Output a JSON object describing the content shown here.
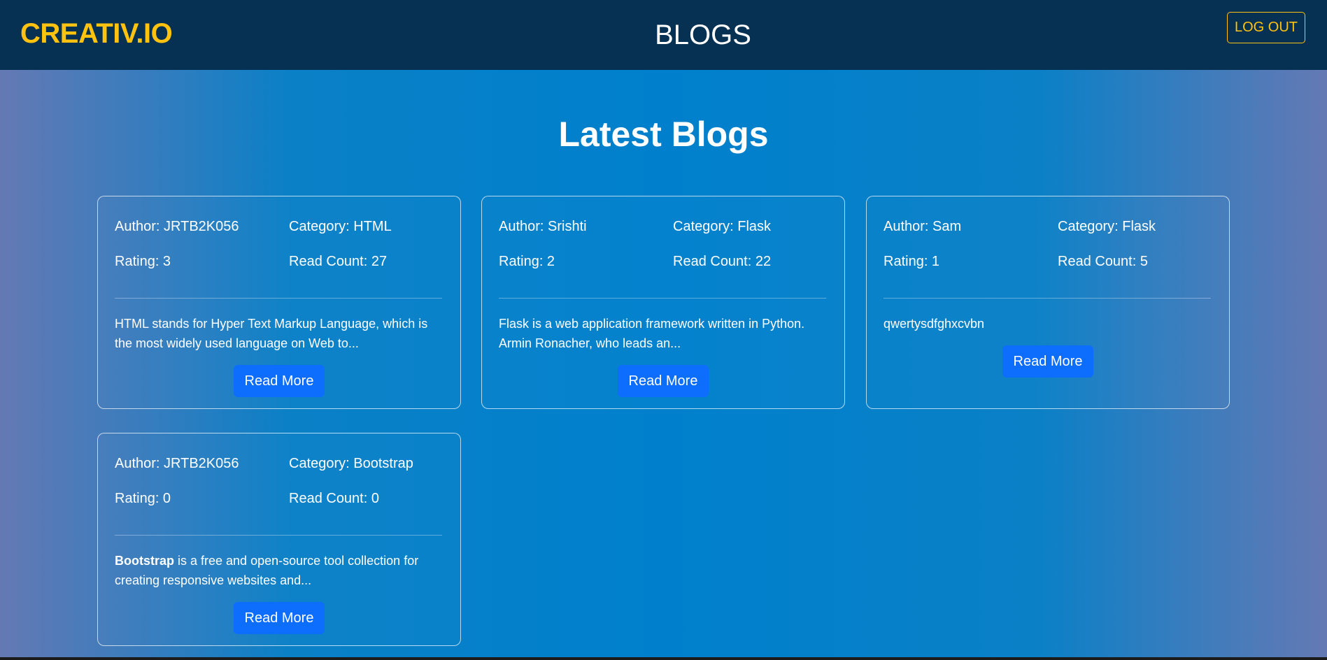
{
  "navbar": {
    "brand": "CREATIV.IO",
    "title": "BLOGS",
    "logout_label": "LOG OUT"
  },
  "main": {
    "heading": "Latest Blogs",
    "cards": [
      {
        "author": "Author: JRTB2K056",
        "category": "Category: HTML",
        "rating": "Rating: 3",
        "read_count": "Read Count: 27",
        "excerpt_bold": "",
        "excerpt": "HTML stands for Hyper Text Markup Language, which is the most widely used language on Web to...",
        "button": "Read More"
      },
      {
        "author": "Author: Srishti",
        "category": "Category: Flask",
        "rating": "Rating: 2",
        "read_count": "Read Count: 22",
        "excerpt_bold": "",
        "excerpt": "Flask is a web application framework written in Python. Armin Ronacher, who leads an...",
        "button": "Read More"
      },
      {
        "author": "Author: Sam",
        "category": "Category: Flask",
        "rating": "Rating: 1",
        "read_count": "Read Count: 5",
        "excerpt_bold": "",
        "excerpt": "qwertysdfghxcvbn",
        "button": "Read More"
      },
      {
        "author": "Author: JRTB2K056",
        "category": "Category: Bootstrap",
        "rating": "Rating: 0",
        "read_count": "Read Count: 0",
        "excerpt_bold": "Bootstrap",
        "excerpt": " is a free and open-source tool collection for creating responsive websites and...",
        "button": "Read More"
      }
    ]
  },
  "colors": {
    "navbar_bg": "#073152",
    "brand": "#ffc20e",
    "button_primary": "#0d6efd"
  }
}
